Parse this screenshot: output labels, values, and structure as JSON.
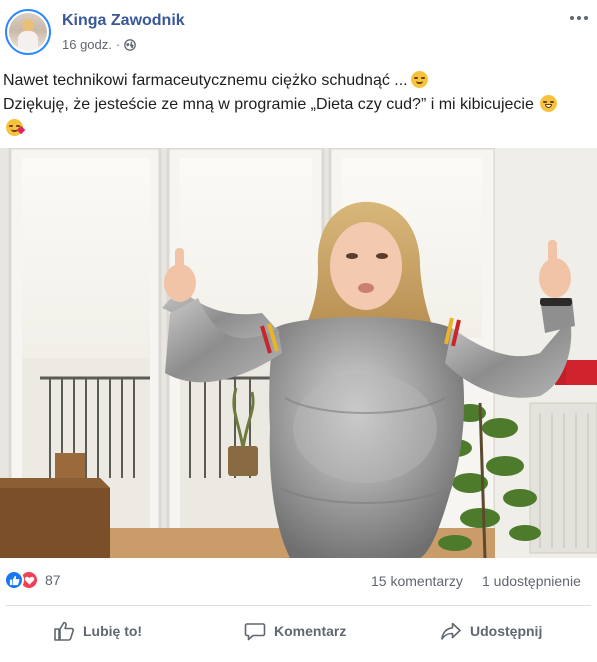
{
  "post": {
    "author": "Kinga Zawodnik",
    "timestamp": "16 godz.",
    "privacy_icon": "globe-icon",
    "more_icon": "more-horizontal-icon",
    "text_line1": "Nawet technikowi farmaceutycznemu ciężko schudnąć ...",
    "text_line2": "Dziękuję, że jesteście ze mną w programie „Dieta czy cud?” i mi kibicujecie",
    "emojis": [
      "relieved-face",
      "grinning-face",
      "face-blowing-kiss"
    ]
  },
  "stats": {
    "reaction_types": [
      "like",
      "love"
    ],
    "reaction_count": "87",
    "comments": "15 komentarzy",
    "shares": "1 udostępnienie"
  },
  "actions": {
    "like_label": "Lubię to!",
    "comment_label": "Komentarz",
    "share_label": "Udostępnij"
  },
  "colors": {
    "author_link": "#385898",
    "secondary_text": "#606770",
    "like_blue": "#1877f2",
    "love_red": "#f33e58",
    "avatar_ring": "#2d88ff"
  }
}
